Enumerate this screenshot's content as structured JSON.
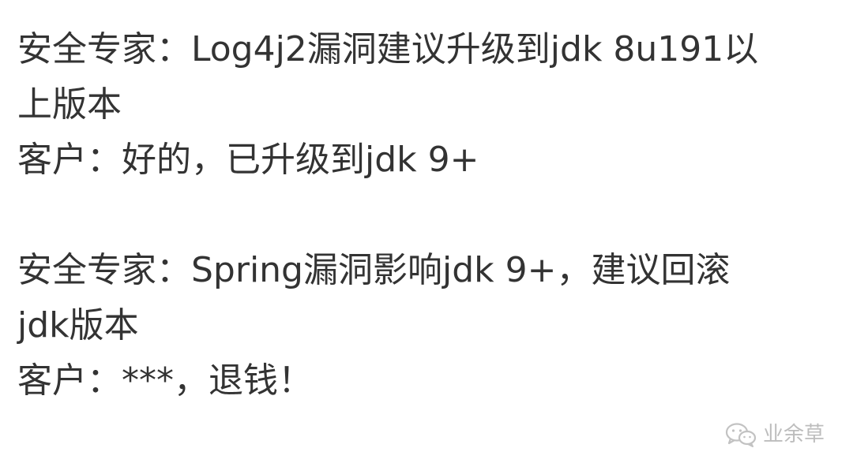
{
  "conversation": {
    "lines": [
      "安全专家：Log4j2漏洞建议升级到jdk 8u191以",
      "上版本",
      "客户：好的，已升级到jdk 9+",
      "",
      "安全专家：Spring漏洞影响jdk 9+，建议回滚",
      "jdk版本",
      "客户：***，退钱！"
    ]
  },
  "watermark": {
    "text": "业余草",
    "icon": "wechat-icon"
  }
}
